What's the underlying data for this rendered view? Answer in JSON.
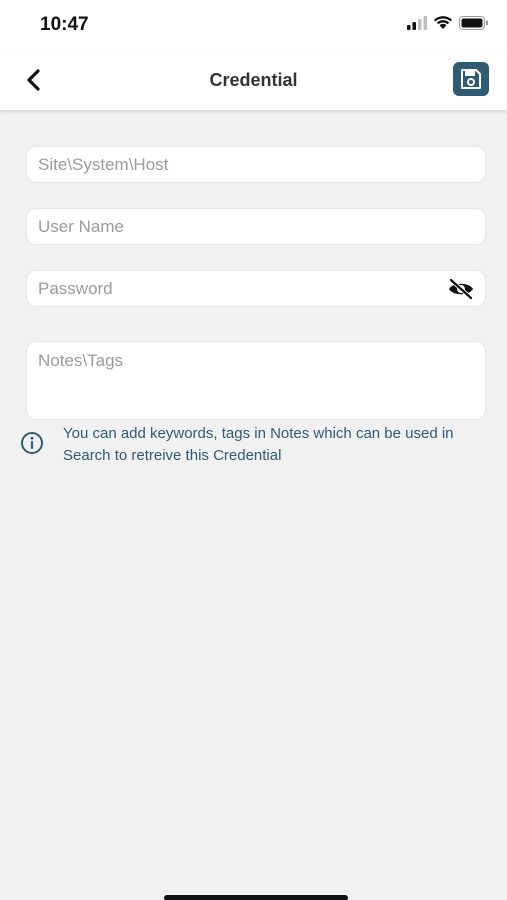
{
  "status_bar": {
    "time": "10:47",
    "icons": [
      "cellular-signal-icon",
      "wifi-icon",
      "battery-icon"
    ]
  },
  "nav": {
    "title": "Credential",
    "back_icon": "chevron-left-icon",
    "save_icon": "floppy-disk-icon"
  },
  "form": {
    "site": {
      "placeholder": "Site\\System\\Host",
      "value": ""
    },
    "username": {
      "placeholder": "User Name",
      "value": ""
    },
    "password": {
      "placeholder": "Password",
      "value": "",
      "toggle_icon": "eye-off-icon"
    },
    "notes": {
      "placeholder": "Notes\\Tags",
      "value": ""
    }
  },
  "info": {
    "icon": "info-circle-icon",
    "text": "You can add keywords, tags in Notes which can be used in Search to retreive this Credential"
  },
  "colors": {
    "accent": "#2f5b74",
    "background": "#f1f1f1",
    "placeholder": "#9b9b9b"
  }
}
